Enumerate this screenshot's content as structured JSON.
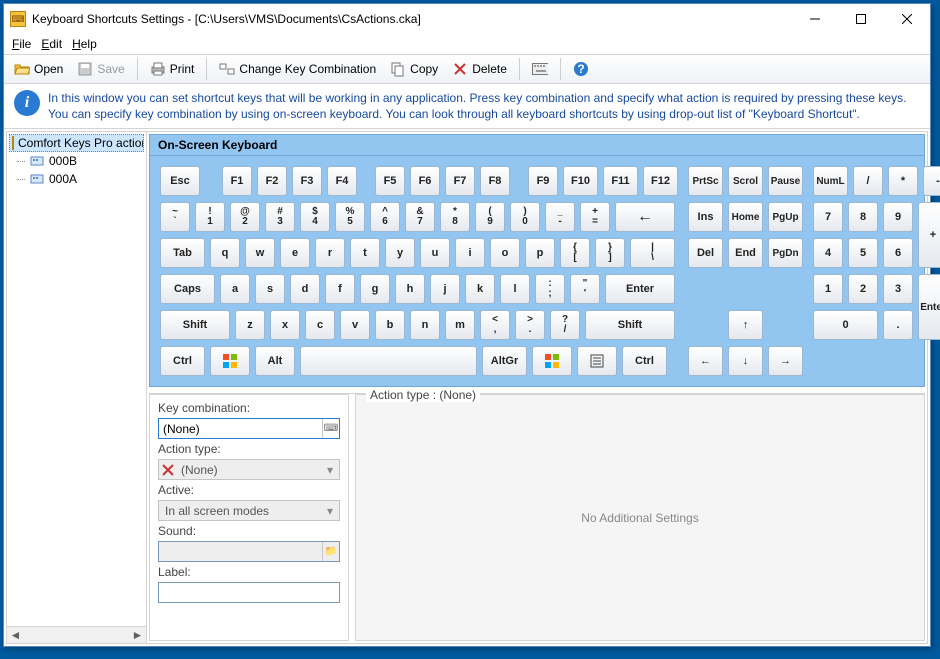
{
  "title": "Keyboard Shortcuts Settings - [C:\\Users\\VMS\\Documents\\CsActions.cka]",
  "menu": {
    "file": "File",
    "edit": "Edit",
    "help": "Help"
  },
  "toolbar": {
    "open": "Open",
    "save": "Save",
    "print": "Print",
    "change": "Change Key Combination",
    "copy": "Copy",
    "delete": "Delete"
  },
  "info": "In this window you can set shortcut keys that will be working in any application. Press key combination and specify what action is required by pressing these keys. You can specify key combination by using on-screen keyboard. You can look through all keyboard shortcuts by using drop-out list of \"Keyboard Shortcut\".",
  "tree": {
    "root": "Comfort Keys Pro actions",
    "items": [
      "000B",
      "000A"
    ]
  },
  "kb_header": "On-Screen Keyboard",
  "keys": {
    "esc": "Esc",
    "f1": "F1",
    "f2": "F2",
    "f3": "F3",
    "f4": "F4",
    "f5": "F5",
    "f6": "F6",
    "f7": "F7",
    "f8": "F8",
    "f9": "F9",
    "f10": "F10",
    "f11": "F11",
    "f12": "F12",
    "prtsc": "PrtSc",
    "scrol": "Scrol",
    "pause": "Pause",
    "tilde_top": "~",
    "tilde_bot": "`",
    "k1t": "!",
    "k1b": "1",
    "k2t": "@",
    "k2b": "2",
    "k3t": "#",
    "k3b": "3",
    "k4t": "$",
    "k4b": "4",
    "k5t": "%",
    "k5b": "5",
    "k6t": "^",
    "k6b": "6",
    "k7t": "&",
    "k7b": "7",
    "k8t": "*",
    "k8b": "8",
    "k9t": "(",
    "k9b": "9",
    "k0t": ")",
    "k0b": "0",
    "dasht": "_",
    "dashb": "-",
    "eqt": "+",
    "eqb": "=",
    "back": "←",
    "tab": "Tab",
    "q": "q",
    "w": "w",
    "e": "e",
    "r": "r",
    "t": "t",
    "y": "y",
    "u": "u",
    "i": "i",
    "o": "o",
    "p": "p",
    "lbt": "{",
    "lbb": "[",
    "rbt": "}",
    "rbb": "]",
    "bslt": "|",
    "bslb": "\\",
    "caps": "Caps",
    "a": "a",
    "s": "s",
    "d": "d",
    "f": "f",
    "g": "g",
    "h": "h",
    "j": "j",
    "k": "k",
    "l": "l",
    "semit": ":",
    "semib": ";",
    "quott": "\"",
    "quotb": "'",
    "enter": "Enter",
    "shift": "Shift",
    "z": "z",
    "x": "x",
    "c": "c",
    "v": "v",
    "b": "b",
    "n": "n",
    "m": "m",
    "commat": "<",
    "commab": ",",
    "dott": ">",
    "dotb": ".",
    "slasht": "?",
    "slashb": "/",
    "ctrl": "Ctrl",
    "alt": "Alt",
    "altgr": "AltGr",
    "ins": "Ins",
    "home": "Home",
    "pgup": "PgUp",
    "del": "Del",
    "end": "End",
    "pgdn": "PgDn",
    "up": "↑",
    "left": "←",
    "down": "↓",
    "right": "→",
    "numl": "NumL",
    "ndiv": "/",
    "nmul": "*",
    "nsub": "-",
    "nadd": "+",
    "nent": "Enter",
    "n7": "7",
    "n8": "8",
    "n9": "9",
    "n4": "4",
    "n5": "5",
    "n6": "6",
    "n1": "1",
    "n2": "2",
    "n3": "3",
    "n0": "0",
    "ndot": "."
  },
  "form": {
    "keycomb_label": "Key combination:",
    "keycomb_value": "(None)",
    "actiontype_label": "Action type:",
    "actiontype_value": "(None)",
    "active_label": "Active:",
    "active_value": "In all screen modes",
    "sound_label": "Sound:",
    "sound_value": "",
    "label_label": "Label:",
    "label_value": ""
  },
  "settings": {
    "header": "Action type : (None)",
    "noadd": "No Additional Settings"
  }
}
